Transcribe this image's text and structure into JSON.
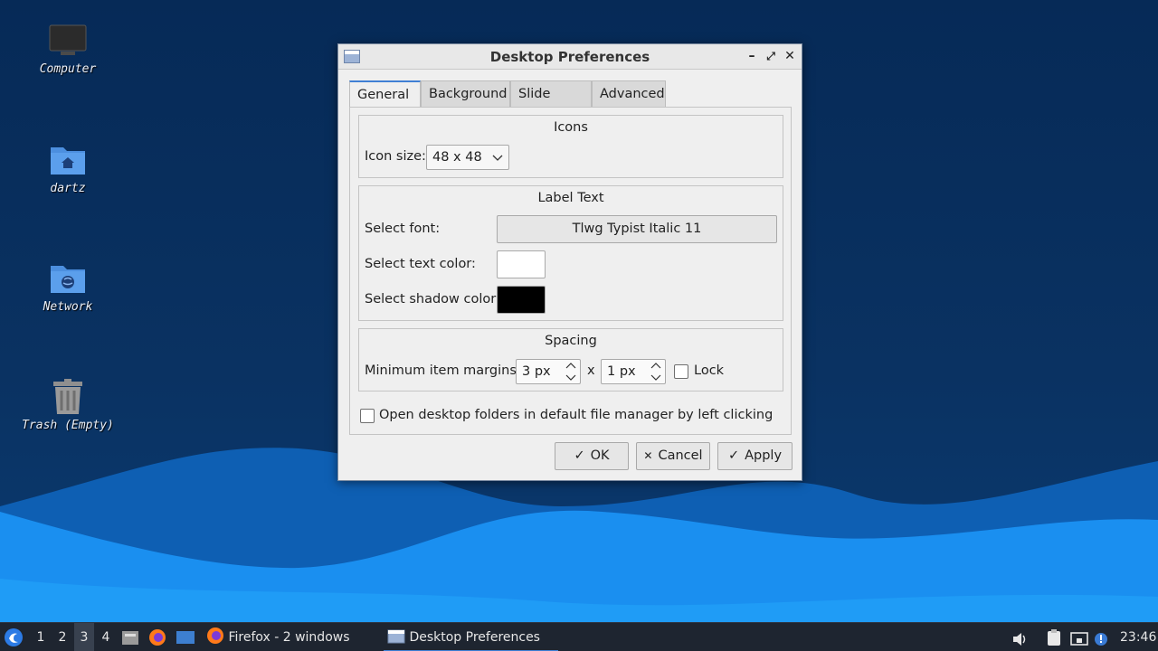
{
  "desktop": {
    "icons": [
      {
        "label": "Computer",
        "icon": "computer-icon"
      },
      {
        "label": "dartz",
        "icon": "home-folder-icon"
      },
      {
        "label": "Network",
        "icon": "network-folder-icon"
      },
      {
        "label": "Trash (Empty)",
        "icon": "trash-icon"
      }
    ]
  },
  "dialog": {
    "title": "Desktop Preferences",
    "tabs": [
      "General",
      "Background",
      "Slide Show",
      "Advanced"
    ],
    "active_tab": "General",
    "icons_group": {
      "title": "Icons",
      "icon_size_label": "Icon size:",
      "icon_size_value": "48 x 48"
    },
    "label_text_group": {
      "title": "Label Text",
      "font_label": "Select font:",
      "font_value": "Tlwg Typist Italic 11",
      "text_color_label": "Select text color:",
      "text_color": "#ffffff",
      "shadow_color_label": "Select shadow color:",
      "shadow_color": "#000000"
    },
    "spacing_group": {
      "title": "Spacing",
      "margins_label": "Minimum item margins:",
      "margin_x": "3 px",
      "separator": "x",
      "margin_y": "1 px",
      "lock_label": "Lock",
      "lock_checked": false
    },
    "open_folders_label": "Open desktop folders in default file manager by left clicking",
    "open_folders_checked": false,
    "buttons": {
      "ok": "OK",
      "cancel": "Cancel",
      "apply": "Apply"
    }
  },
  "taskbar": {
    "workspaces": [
      "1",
      "2",
      "3",
      "4"
    ],
    "active_workspace": "3",
    "tasks": [
      {
        "label": "Firefox - 2 windows",
        "icon": "firefox-icon"
      },
      {
        "label": "Desktop Preferences",
        "icon": "window-icon"
      }
    ],
    "clock": "23:46"
  },
  "colors": {
    "accent": "#3f7fd4",
    "desktop_bg": "#062a57",
    "wave_light": "#1a8ff0",
    "taskbar_bg": "#1e2530"
  }
}
